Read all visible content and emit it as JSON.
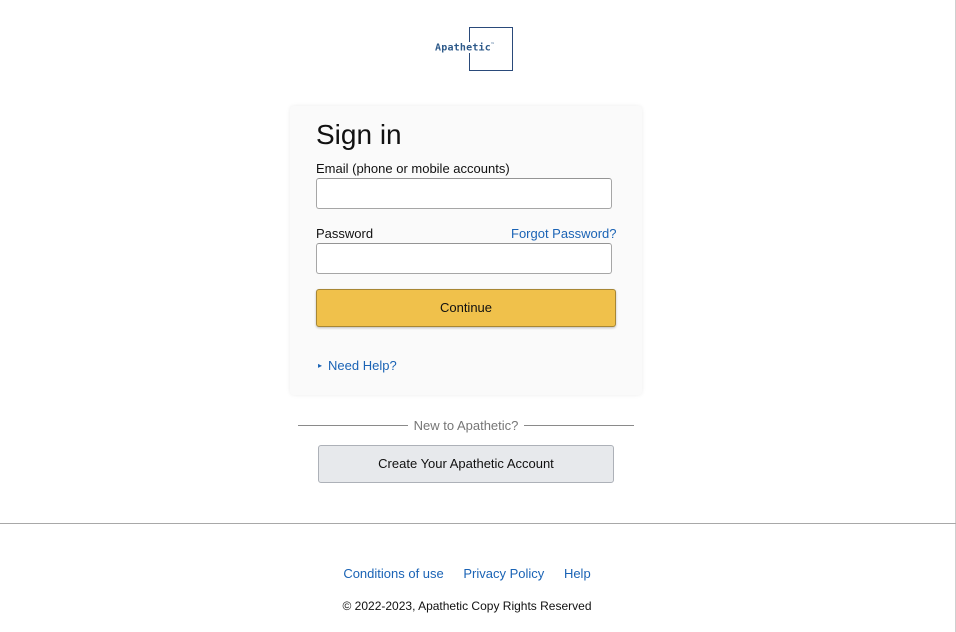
{
  "logo": {
    "text": "Apathetic",
    "tm": "™"
  },
  "signin": {
    "title": "Sign in",
    "email_label": "Email (phone or mobile accounts)",
    "email_value": "",
    "password_label": "Password",
    "password_value": "",
    "forgot_password": "Forgot Password?",
    "continue_label": "Continue",
    "need_help": "Need Help?"
  },
  "new_account": {
    "divider_text": "New to Apathetic?",
    "create_label": "Create Your Apathetic Account"
  },
  "footer": {
    "links": [
      "Conditions of use",
      "Privacy Policy",
      "Help"
    ],
    "copyright": "© 2022-2023, Apathetic Copy Rights Reserved"
  },
  "colors": {
    "link": "#1a63b5",
    "continue_button": "#f0c14b",
    "create_button": "#e7e9ec",
    "logo": "#2e5a8a"
  }
}
